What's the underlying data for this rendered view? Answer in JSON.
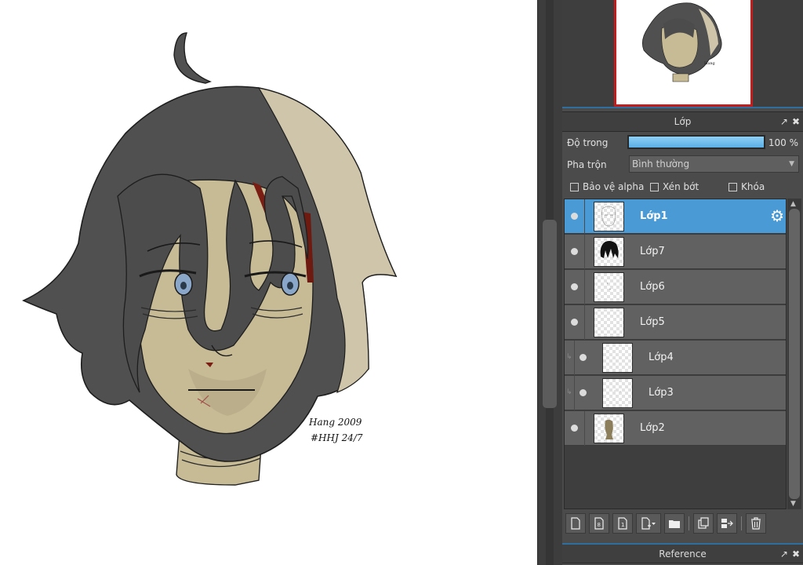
{
  "canvas": {
    "signature_line1": "Hang 2009",
    "signature_line2": "#HHJ 24/7"
  },
  "layer_panel": {
    "title": "Lớp",
    "opacity_label": "Độ trong",
    "opacity_percent": 100,
    "opacity_value": "100 %",
    "blend_label": "Pha trộn",
    "blend_value": "Bình thường",
    "protect_alpha": "Bảo vệ alpha",
    "clipping": "Xén bớt",
    "lock": "Khóa",
    "layers": [
      {
        "name": "Lớp1",
        "selected": true,
        "thumbnail": "sketch-face"
      },
      {
        "name": "Lớp7",
        "selected": false,
        "thumbnail": "black-hair"
      },
      {
        "name": "Lớp6",
        "selected": false,
        "thumbnail": "faint-lines"
      },
      {
        "name": "Lớp5",
        "selected": false,
        "thumbnail": "empty"
      },
      {
        "name": "Lớp4",
        "selected": false,
        "clipped": true,
        "thumbnail": "empty"
      },
      {
        "name": "Lớp3",
        "selected": false,
        "clipped": true,
        "thumbnail": "faint-dots"
      },
      {
        "name": "Lớp2",
        "selected": false,
        "thumbnail": "skin-silhouette"
      }
    ]
  },
  "reference_panel": {
    "title": "Reference"
  },
  "colors": {
    "accent": "#4a9bd5",
    "hair": "#505050",
    "skin": "#c7bb96",
    "highlight": "#cfc5ab",
    "eyes": "#8aa7c9",
    "blood": "#7a1e13"
  }
}
